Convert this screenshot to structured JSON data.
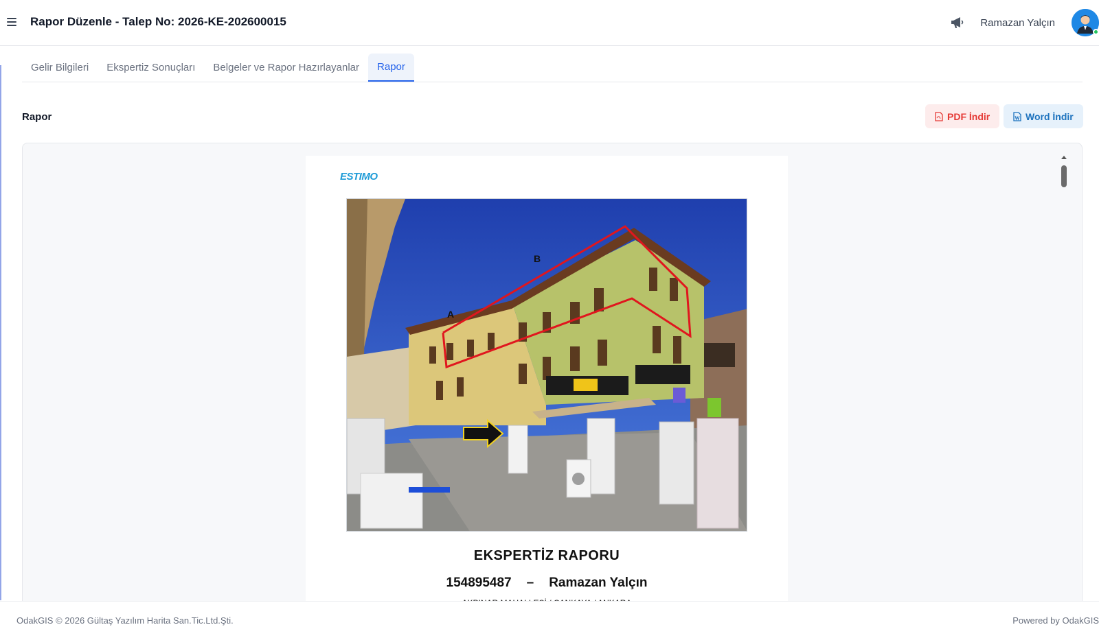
{
  "header": {
    "title": "Rapor Düzenle - Talep No: 2026-KE-202600015",
    "user_name": "Ramazan Yalçın"
  },
  "tabs": [
    {
      "label": "Gelir Bilgileri",
      "active": false
    },
    {
      "label": "Ekspertiz Sonuçları",
      "active": false
    },
    {
      "label": "Belgeler ve Rapor Hazırlayanlar",
      "active": false
    },
    {
      "label": "Rapor",
      "active": true
    }
  ],
  "section": {
    "label": "Rapor",
    "pdf_button": "PDF İndir",
    "word_button": "Word İndir"
  },
  "document": {
    "logo": "ESTIMO",
    "title": "EKSPERTİZ RAPORU",
    "report_no": "154895487",
    "separator": "–",
    "owner": "Ramazan Yalçın",
    "address": "AKPINAR MAHALLESİ / ÇANKAYA / ANKARA",
    "photo_labels": {
      "a": "A",
      "b": "B"
    }
  },
  "footer": {
    "copyright": "OdakGIS © 2026 Gültaş Yazılım Harita San.Tic.Ltd.Şti.",
    "powered": "Powered by OdakGIS"
  },
  "colors": {
    "accent": "#2563eb",
    "pdf": "#e53935",
    "word": "#1e73be",
    "logo": "#1e9bd7"
  }
}
